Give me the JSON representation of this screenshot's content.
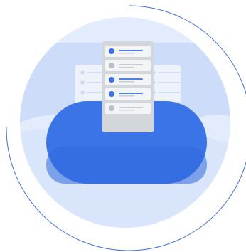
{
  "illustration": {
    "colors": {
      "background": "#ffffff",
      "outer_arc": "#3f6fdc",
      "circle_light": "#e3ecfc",
      "circle_mid": "#cddcf8",
      "cloud": "#3b74e6",
      "cloud_dark": "#2d63d6",
      "server_frame": "#d3d6db",
      "server_panel": "#f3f4f6",
      "card_light": "#eef2fb",
      "dot_active": "#3a6fe5",
      "dot_inactive": "#b9bec7",
      "line_active": "#4c7fe8",
      "line_inactive": "#c8ccd3"
    },
    "server_rows": [
      {
        "active": true
      },
      {
        "active": false
      },
      {
        "active": true
      },
      {
        "active": true
      },
      {
        "active": false
      }
    ]
  }
}
